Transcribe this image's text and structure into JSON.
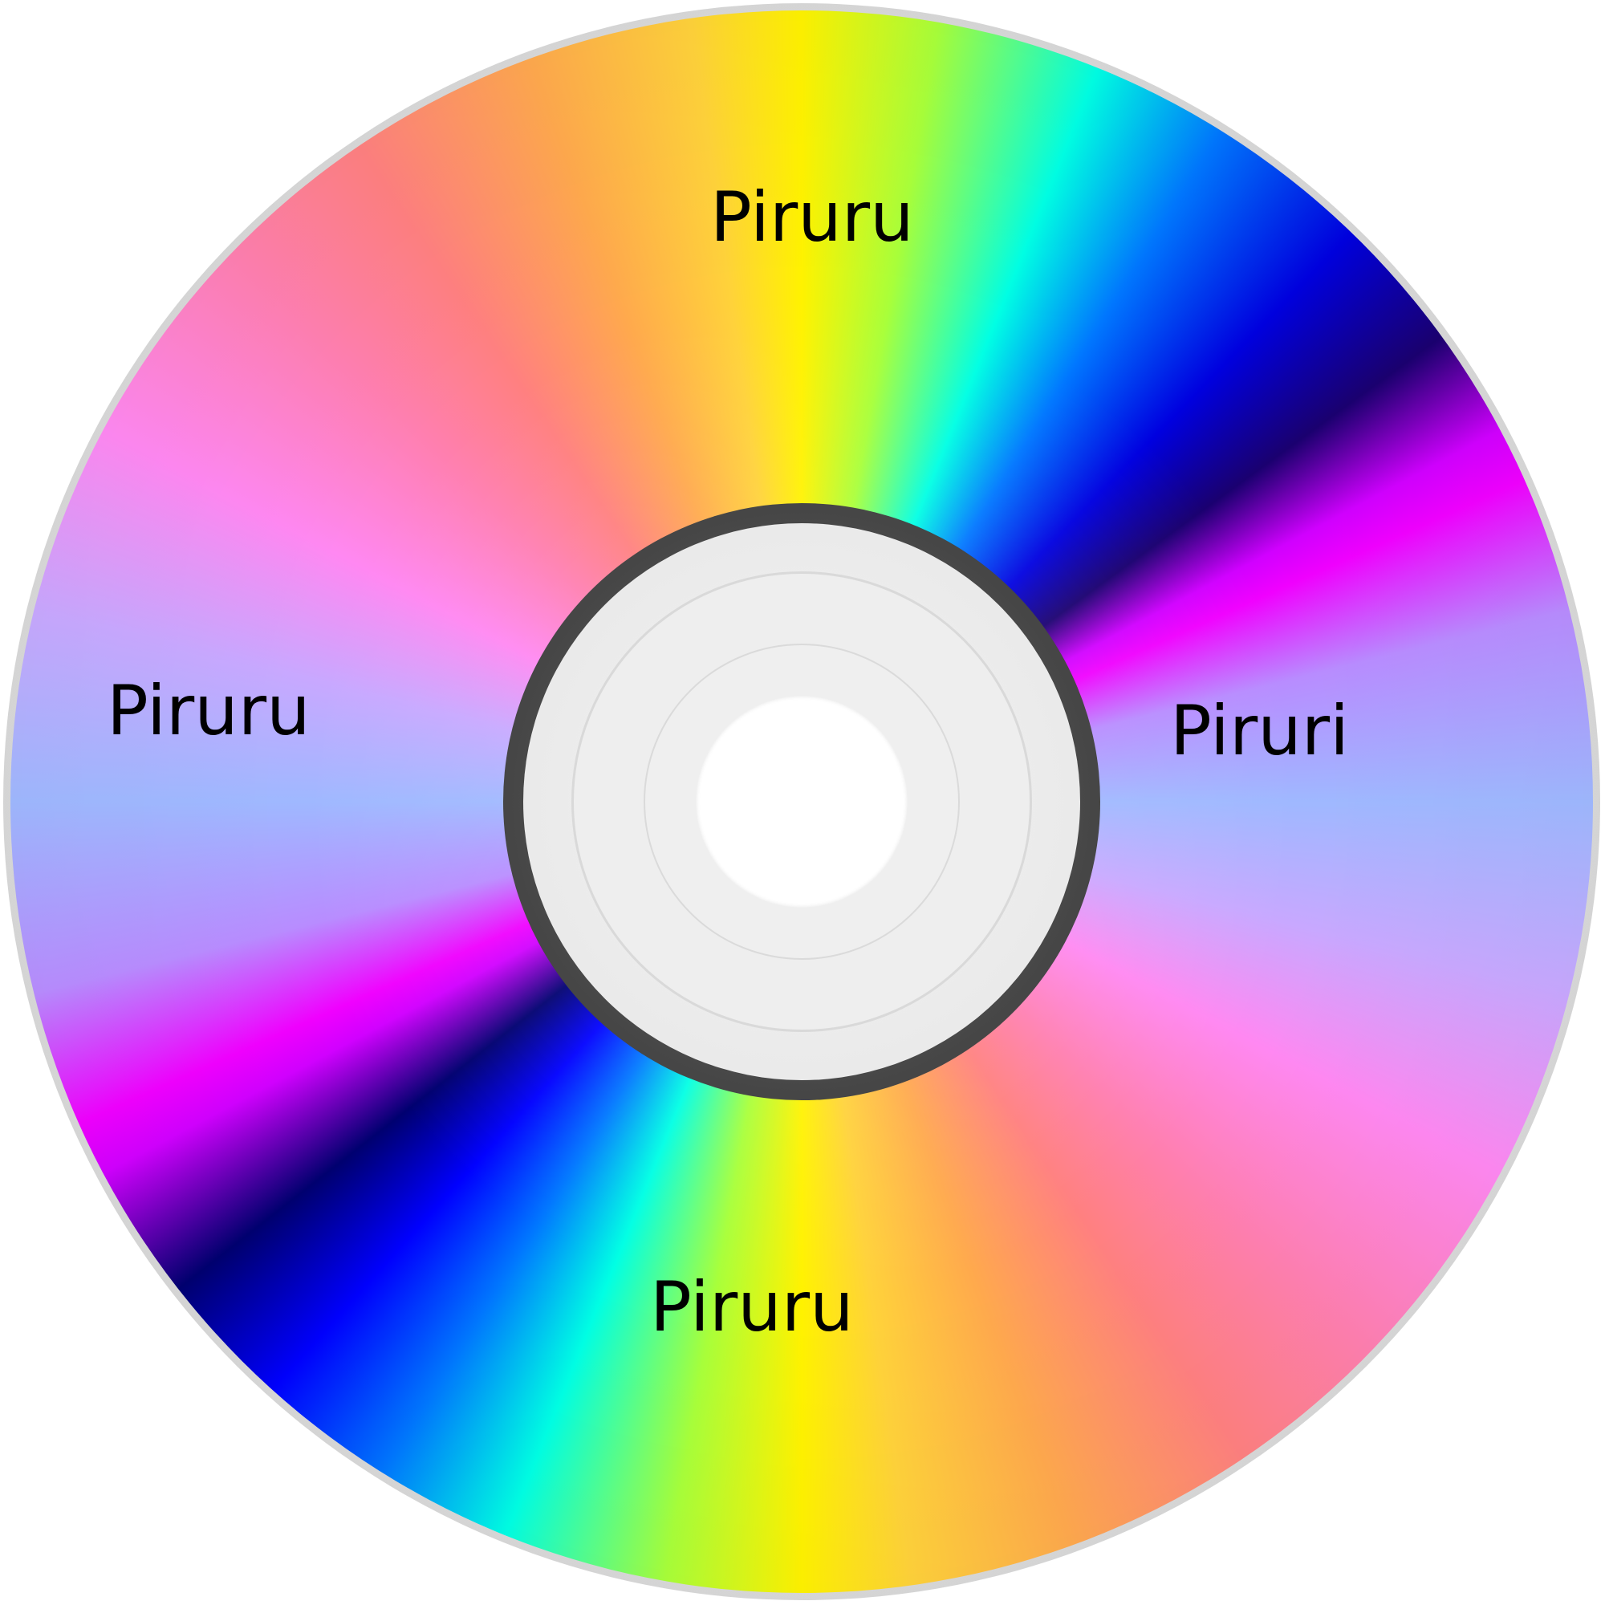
{
  "disc": {
    "labels": {
      "top": "Piruru",
      "left": "Piruru",
      "right": "Piruri",
      "bottom": "Piruru"
    }
  }
}
